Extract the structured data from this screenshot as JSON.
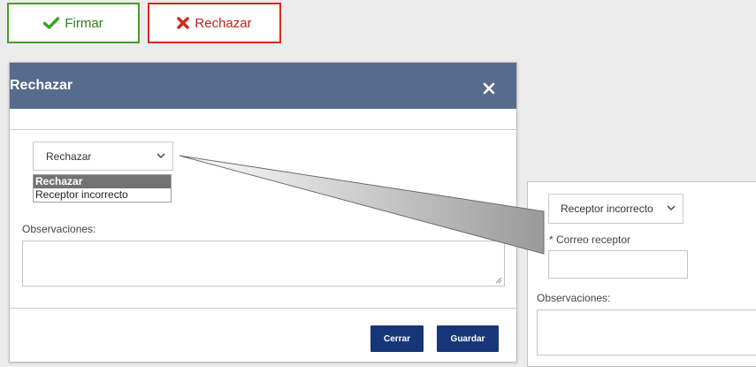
{
  "toolbar": {
    "sign_label": "Firmar",
    "reject_label": "Rechazar",
    "sign_color": "#4a9a2e",
    "reject_color": "#d5281e",
    "sign_icon": "check-icon",
    "reject_icon": "x-icon"
  },
  "modal": {
    "title": "Rechazar",
    "close_icon": "close-icon",
    "header_color": "#576b8c",
    "select_value": "Rechazar",
    "dropdown_options": [
      "Rechazar",
      "Receptor incorrecto"
    ],
    "observations_label": "Observaciones:",
    "close_button": "Cerrar",
    "save_button": "Guardar",
    "button_color": "#17367a"
  },
  "zoom": {
    "select_value": "Receptor incorrecto",
    "email_label": "* Correo receptor",
    "observations_label": "Observaciones:"
  }
}
